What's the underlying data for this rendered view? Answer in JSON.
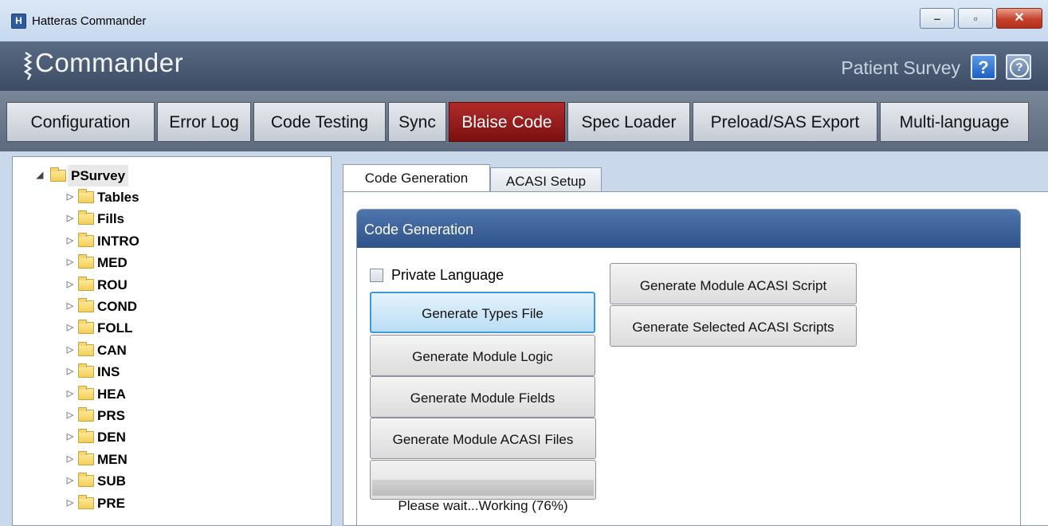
{
  "window": {
    "title": "Hatteras Commander",
    "icon_letter": "H",
    "controls": {
      "minimize": "‒",
      "maximize": "▫",
      "close": "✕"
    }
  },
  "header": {
    "app_name": "Commander",
    "subtitle": "Patient Survey",
    "help_icon": "?",
    "info_icon": "?"
  },
  "main_tabs": [
    {
      "label": "Configuration",
      "active": false
    },
    {
      "label": "Error Log",
      "active": false
    },
    {
      "label": "Code Testing",
      "active": false
    },
    {
      "label": "Sync",
      "active": false
    },
    {
      "label": "Blaise Code",
      "active": true
    },
    {
      "label": "Spec Loader",
      "active": false
    },
    {
      "label": "Preload/SAS Export",
      "active": false
    },
    {
      "label": "Multi-language",
      "active": false
    }
  ],
  "tree": {
    "root": "PSurvey",
    "children": [
      "Tables",
      "Fills",
      "INTRO",
      "MED",
      "ROU",
      "COND",
      "FOLL",
      "CAN",
      "INS",
      "HEA",
      "PRS",
      "DEN",
      "MEN",
      "SUB",
      "PRE"
    ]
  },
  "panel_tabs": [
    {
      "label": "Code Generation",
      "active": true
    },
    {
      "label": "ACASI Setup",
      "active": false
    }
  ],
  "code_generation": {
    "title": "Code Generation",
    "private_language_label": "Private Language",
    "private_language_checked": false,
    "left_buttons": [
      "Generate Types File",
      "Generate Module Logic",
      "Generate Module Fields",
      "Generate Module ACASI Files"
    ],
    "right_buttons": [
      "Generate Module ACASI Script",
      "Generate Selected ACASI Scripts"
    ],
    "status": "Please wait...Working (76%)",
    "progress": 0.76
  },
  "colors": {
    "active_tab": "#9b1c1c",
    "header": "#4a5a73",
    "group_header": "#3b62a0"
  }
}
